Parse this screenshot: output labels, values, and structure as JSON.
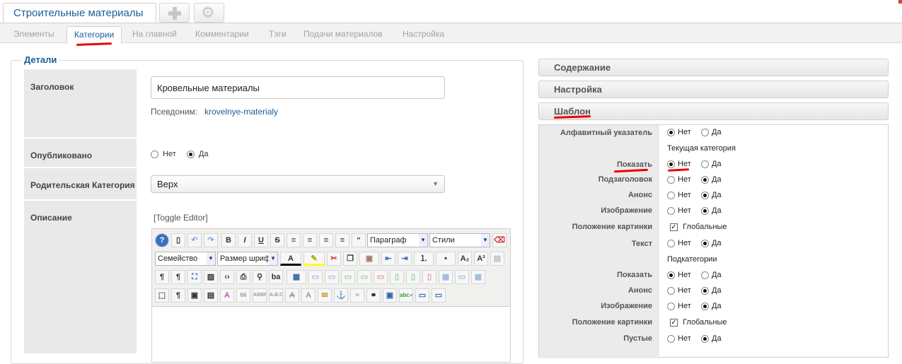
{
  "app": {
    "title": "Строительные материалы"
  },
  "tabs": [
    {
      "label": "Элементы"
    },
    {
      "label": "Категории"
    },
    {
      "label": "На главной"
    },
    {
      "label": "Комментарии"
    },
    {
      "label": "Тэги"
    },
    {
      "label": "Подачи материалов"
    },
    {
      "label": "Настройка"
    }
  ],
  "details": {
    "legend": "Детали",
    "title_label": "Заголовок",
    "title_value": "Кровельные материалы",
    "alias_label": "Псевдоним:",
    "alias_value": "krovelnye-materialy",
    "published_label": "Опубликовано",
    "published_no": "Нет",
    "published_yes": "Да",
    "parent_label": "Родительская Категория",
    "parent_value": "Верх",
    "description_label": "Описание",
    "toggle_editor": "[Toggle Editor]"
  },
  "editor": {
    "format_select": "Параграф",
    "styles_select": "Стили",
    "font_family_select": "Семейство",
    "font_size_select": "Размер шрифт"
  },
  "accordion": {
    "content": "Содержание",
    "settings": "Настройка",
    "template": "Шаблон"
  },
  "template": {
    "alpha_index_label": "Алфавитный указатель",
    "current_category_header": "Текущая категория",
    "subcategories_header": "Подкатегории",
    "no": "Нет",
    "yes": "Да",
    "global": "Глобальные",
    "rows_current": [
      {
        "label": "Показать",
        "value": "Нет"
      },
      {
        "label": "Подзаголовок",
        "value": "Да"
      },
      {
        "label": "Анонс",
        "value": "Да"
      },
      {
        "label": "Изображение",
        "value": "Да"
      },
      {
        "label": "Положение картинки",
        "value": "Глобальные"
      },
      {
        "label": "Текст",
        "value": "Да"
      }
    ],
    "rows_sub": [
      {
        "label": "Показать",
        "value": "Нет"
      },
      {
        "label": "Анонс",
        "value": "Да"
      },
      {
        "label": "Изображение",
        "value": "Да"
      },
      {
        "label": "Положение картинки",
        "value": "Глобальные"
      },
      {
        "label": "Пустые",
        "value": "Да"
      }
    ],
    "alpha_index_value": "Нет"
  },
  "colors": {
    "accent": "#1a5e9a",
    "annotation_red": "#e00000"
  }
}
